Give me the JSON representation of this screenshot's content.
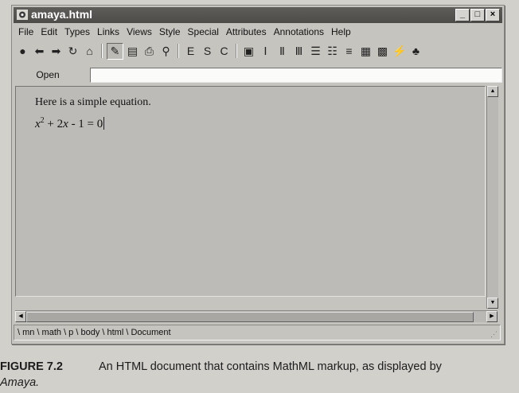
{
  "window": {
    "title": "amaya.html",
    "controls": {
      "minimize": "_",
      "maximize": "□",
      "close": "×"
    }
  },
  "menubar": {
    "items": [
      "File",
      "Edit",
      "Types",
      "Links",
      "Views",
      "Style",
      "Special",
      "Attributes",
      "Annotations",
      "Help"
    ]
  },
  "toolbar": {
    "buttons": [
      {
        "name": "stop-icon",
        "glyph": "●"
      },
      {
        "name": "back-icon",
        "glyph": "⬅"
      },
      {
        "name": "forward-icon",
        "glyph": "➡"
      },
      {
        "name": "reload-icon",
        "glyph": "↻"
      },
      {
        "name": "home-icon",
        "glyph": "⌂"
      },
      {
        "name": "edit-mode-icon",
        "glyph": "✎",
        "pressed": true
      },
      {
        "name": "save-icon",
        "glyph": "▤"
      },
      {
        "name": "print-icon",
        "glyph": "⎙"
      },
      {
        "name": "find-icon",
        "glyph": "⚲"
      },
      {
        "name": "emphasis-icon",
        "glyph": "E"
      },
      {
        "name": "strong-icon",
        "glyph": "S"
      },
      {
        "name": "code-icon",
        "glyph": "C"
      },
      {
        "name": "image-icon",
        "glyph": "▣"
      },
      {
        "name": "heading1-icon",
        "glyph": "Ⅰ"
      },
      {
        "name": "heading2-icon",
        "glyph": "Ⅱ"
      },
      {
        "name": "heading3-icon",
        "glyph": "Ⅲ"
      },
      {
        "name": "bulleted-list-icon",
        "glyph": "☰"
      },
      {
        "name": "numbered-list-icon",
        "glyph": "☷"
      },
      {
        "name": "definition-list-icon",
        "glyph": "≡"
      },
      {
        "name": "table-icon",
        "glyph": "▦"
      },
      {
        "name": "table-grid-icon",
        "glyph": "▩"
      },
      {
        "name": "link-icon",
        "glyph": "⚡"
      },
      {
        "name": "math-icon",
        "glyph": "♣"
      }
    ]
  },
  "openbar": {
    "open_label": "Open",
    "url_value": ""
  },
  "document": {
    "paragraph": "Here is a simple equation.",
    "equation": {
      "x": "x",
      "exp": "2",
      "rest": " + 2",
      "x2": "x",
      "tail": " - 1 = 0"
    }
  },
  "statusbar": {
    "path": "\\ mn \\ math \\ p \\ body \\ html \\ Document"
  },
  "caption": {
    "label": "FIGURE 7.2",
    "text": "An HTML document that contains MathML markup, as displayed by",
    "text2": "Amaya."
  }
}
